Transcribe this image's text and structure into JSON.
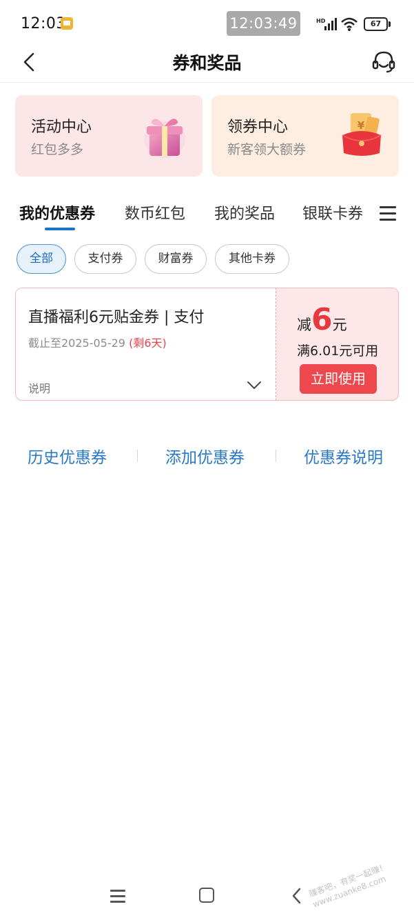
{
  "status_bar": {
    "time": "12:03",
    "clock_overlay": "12:03:49",
    "battery": "67"
  },
  "header": {
    "title": "券和奖品"
  },
  "promo_cards": [
    {
      "title": "活动中心",
      "subtitle": "红包多多"
    },
    {
      "title": "领券中心",
      "subtitle": "新客领大额券"
    }
  ],
  "tabs": [
    {
      "label": "我的优惠券",
      "active": true
    },
    {
      "label": "数币红包",
      "active": false
    },
    {
      "label": "我的奖品",
      "active": false
    },
    {
      "label": "银联卡券",
      "active": false
    }
  ],
  "filters": [
    {
      "label": "全部",
      "active": true
    },
    {
      "label": "支付券",
      "active": false
    },
    {
      "label": "财富券",
      "active": false
    },
    {
      "label": "其他卡券",
      "active": false
    }
  ],
  "coupon": {
    "name": "直播福利6元贴金券 | 支付",
    "expiry": "截止至2025-05-29",
    "remaining": "(剩6天)",
    "description_label": "说明",
    "amount_prefix": "减",
    "amount_value": "6",
    "amount_unit": "元",
    "condition": "满6.01元可用",
    "use_button": "立即使用"
  },
  "links": {
    "history": "历史优惠券",
    "add": "添加优惠券",
    "info": "优惠券说明"
  },
  "watermark": {
    "line1": "赚客吧，有奖一起赚！",
    "line2": "www.zuanke8.com"
  },
  "colors": {
    "accent_blue": "#1a73c8",
    "link_blue": "#2a78c4",
    "coupon_red": "#e8383f",
    "activity_card_bg": "#fde6e8",
    "coupon_card_bg": "#fdeee1"
  },
  "icons": {
    "back": "chevron-left-icon",
    "service": "headset-icon",
    "gift": "gift-box-icon",
    "envelope": "red-envelope-icon",
    "menu": "hamburger-menu-icon",
    "expand": "chevron-down-icon"
  }
}
